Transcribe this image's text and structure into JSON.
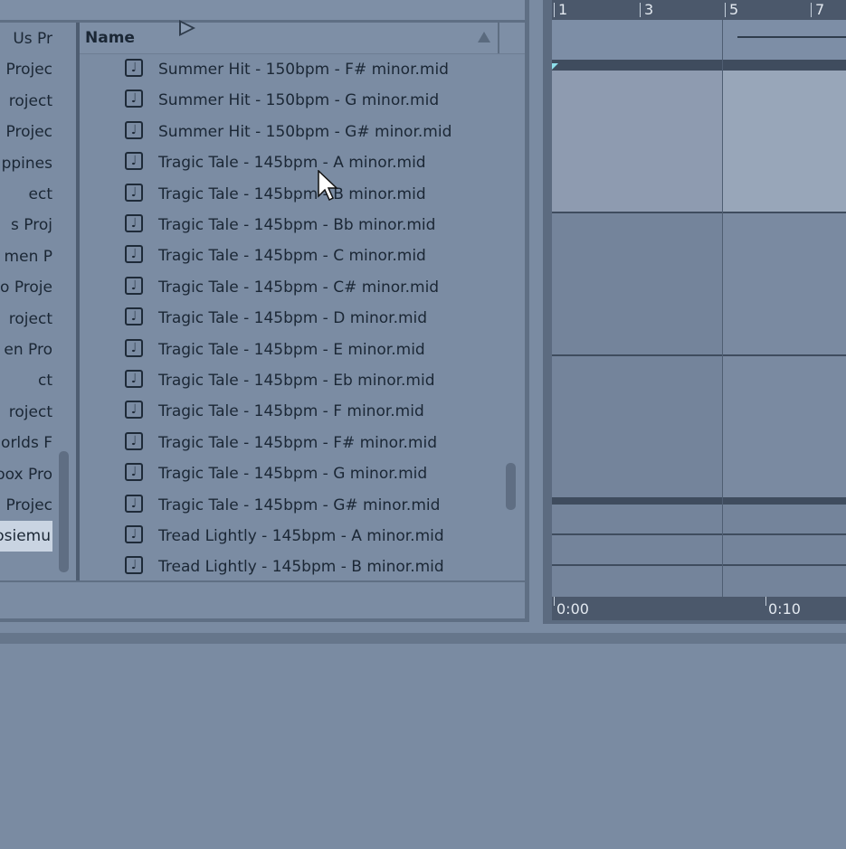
{
  "browser": {
    "column_header": "Name",
    "places": [
      "Us Pr",
      "Projec",
      "roject",
      "Projec",
      "ppines",
      "ect",
      "s Proj",
      "men P",
      "o Proje",
      "roject",
      "en Pro",
      "ct",
      "roject",
      "orlds F",
      "oox Pro",
      "Projec",
      "osiemu"
    ],
    "selected_place_index": 16,
    "files": [
      "Summer Hit - 150bpm - F# minor.mid",
      "Summer Hit - 150bpm - G minor.mid",
      "Summer Hit - 150bpm - G# minor.mid",
      "Tragic Tale - 145bpm - A minor.mid",
      "Tragic Tale - 145bpm - B minor.mid",
      "Tragic Tale - 145bpm - Bb minor.mid",
      "Tragic Tale - 145bpm - C minor.mid",
      "Tragic Tale - 145bpm - C# minor.mid",
      "Tragic Tale - 145bpm - D minor.mid",
      "Tragic Tale - 145bpm - E minor.mid",
      "Tragic Tale - 145bpm - Eb minor.mid",
      "Tragic Tale - 145bpm - F minor.mid",
      "Tragic Tale - 145bpm - F# minor.mid",
      "Tragic Tale - 145bpm - G minor.mid",
      "Tragic Tale - 145bpm - G# minor.mid",
      "Tread Lightly - 145bpm - A minor.mid",
      "Tread Lightly - 145bpm - B minor.mid"
    ],
    "file_icon": "music-note-icon"
  },
  "arrangement": {
    "bar_labels": [
      "1",
      "3",
      "5",
      "7"
    ],
    "time_labels": [
      "0:00",
      "0:10"
    ]
  },
  "colors": {
    "background": "#7a8ba2",
    "selection": "#c9d4e2",
    "locator": "#8ee0ec"
  }
}
